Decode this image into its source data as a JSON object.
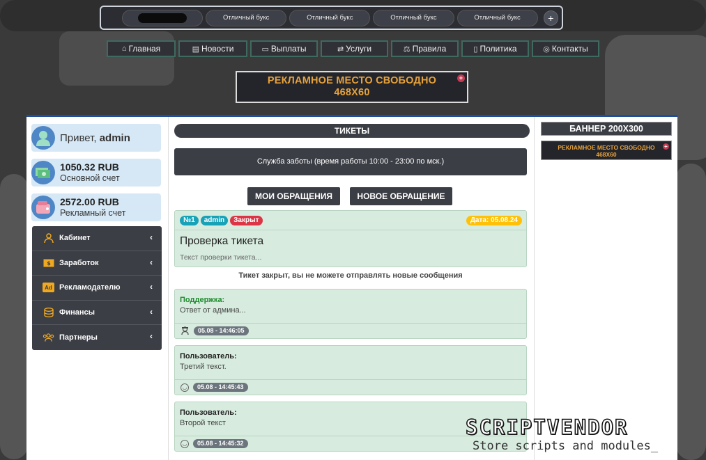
{
  "top_tabs": [
    "Отличный букс",
    "Отличный букс",
    "Отличный букс",
    "Отличный букс"
  ],
  "top_plus": "+",
  "nav": [
    {
      "label": "Главная",
      "icon": "home-icon"
    },
    {
      "label": "Новости",
      "icon": "newspaper-icon"
    },
    {
      "label": "Выплаты",
      "icon": "money-icon"
    },
    {
      "label": "Услуги",
      "icon": "exchange-icon"
    },
    {
      "label": "Правила",
      "icon": "scales-icon"
    },
    {
      "label": "Политика",
      "icon": "document-icon"
    },
    {
      "label": "Контакты",
      "icon": "headset-icon"
    }
  ],
  "ad_top": {
    "line1": "РЕКЛАМНОЕ МЕСТО СВОБОДНО",
    "line2": "468Х60",
    "plus": "+"
  },
  "user": {
    "greeting": "Привет,",
    "name": "admin"
  },
  "balances": [
    {
      "amount": "1050.32 RUB",
      "label": "Основной счет",
      "icon": "money-bills-icon"
    },
    {
      "amount": "2572.00 RUB",
      "label": "Рекламный счет",
      "icon": "wallet-icon"
    }
  ],
  "menu": [
    {
      "label": "Кабинет",
      "icon": "user-icon"
    },
    {
      "label": "Заработок",
      "icon": "cash-icon"
    },
    {
      "label": "Рекламодателю",
      "icon": "ad-icon",
      "icon_text": "Ad"
    },
    {
      "label": "Финансы",
      "icon": "coins-icon"
    },
    {
      "label": "Партнеры",
      "icon": "users-icon"
    }
  ],
  "page_title": "ТИКЕТЫ",
  "support_info": "Служба заботы (время работы 10:00 - 23:00 по мск.)",
  "buttons": {
    "my_requests": "МОИ ОБРАЩЕНИЯ",
    "new_request": "НОВОЕ ОБРАЩЕНИЕ"
  },
  "ticket": {
    "number": "№1",
    "user": "admin",
    "status": "Закрыт",
    "date": "Дата: 05.08.24",
    "subject": "Проверка тикета",
    "preview": "Текст проверки тикета..."
  },
  "closed_note": "Тикет закрыт, вы не можете отправлять новые сообщения",
  "messages": [
    {
      "author": "Поддержка:",
      "text": "Ответ от админа...",
      "time": "05.08 - 14:46:05",
      "support": true
    },
    {
      "author": "Пользователь:",
      "text": "Третий текст.",
      "time": "05.08 - 14:45:43",
      "support": false
    },
    {
      "author": "Пользователь:",
      "text": "Второй текст",
      "time": "05.08 - 14:45:32",
      "support": false
    }
  ],
  "sidebar_banner": {
    "title": "БАННЕР 200Х300",
    "ad_line1": "РЕКЛАМНОЕ МЕСТО СВОБОДНО",
    "ad_line2": "468Х60",
    "plus": "+"
  },
  "watermark": {
    "title": "SCRIPTVENDOR",
    "subtitle": "Store scripts and modules_"
  },
  "colors": {
    "accent_dark": "#3b3e45",
    "ad_text": "#e8a23a",
    "ticket_bg": "#d7ecdf",
    "closed": "#dc3545",
    "info_badge": "#17a2b8",
    "date_badge": "#ffc107",
    "card_bg": "#d6e8f6"
  }
}
